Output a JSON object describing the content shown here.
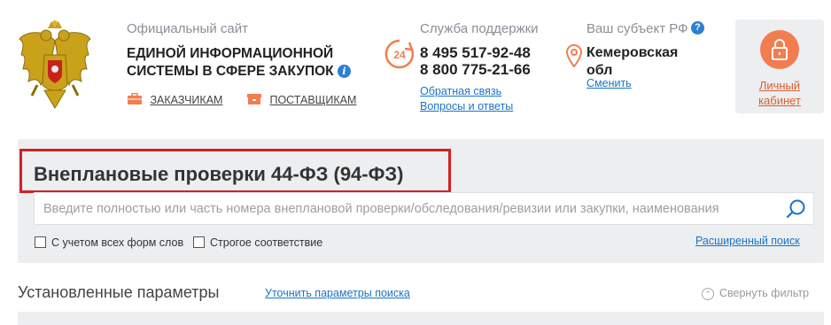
{
  "header": {
    "site_caption": "Официальный сайт",
    "site_name_line1": "ЕДИНОЙ ИНФОРМАЦИОННОЙ",
    "site_name_line2": "СИСТЕМЫ В СФЕРЕ ЗАКУПОК",
    "nav": {
      "customers": "ЗАКАЗЧИКАМ",
      "suppliers": "ПОСТАВЩИКАМ"
    },
    "support": {
      "title": "Служба поддержки",
      "badge": "24",
      "phone1": "8 495 517-92-48",
      "phone2": "8 800 775-21-66",
      "feedback": "Обратная связь",
      "faq": "Вопросы и ответы"
    },
    "region": {
      "title": "Ваш субъект РФ",
      "name_line1": "Кемеровская",
      "name_line2": "обл",
      "change": "Сменить"
    },
    "cabinet": {
      "line1": "Личный",
      "line2": "кабинет"
    },
    "colors": {
      "accent_orange": "#f27d4e",
      "link_blue": "#1a73c8",
      "highlight_red": "#d02222"
    }
  },
  "search": {
    "title": "Внеплановые проверки 44-ФЗ (94-ФЗ)",
    "placeholder": "Введите полностью или часть номера внеплановой проверки/обследования/ревизии или закупки, наименования",
    "value": "",
    "option_word_forms": "С учетом всех форм слов",
    "option_strict": "Строгое соответствие",
    "advanced_link": "Расширенный поиск"
  },
  "params": {
    "title": "Установленные параметры",
    "refine_link": "Уточнить параметры поиска",
    "collapse_link": "Свернуть фильтр"
  }
}
